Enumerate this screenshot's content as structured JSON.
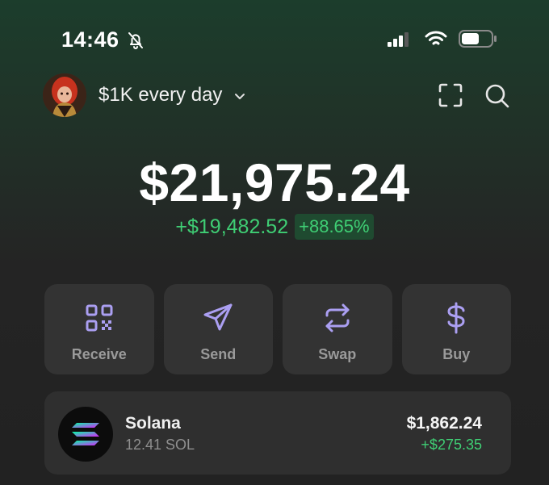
{
  "status_bar": {
    "time": "14:46",
    "icons": [
      "bell-slash-icon",
      "signal-icon",
      "wifi-icon",
      "battery-icon"
    ]
  },
  "header": {
    "account_name": "$1K every day",
    "icons": [
      "avatar",
      "chevron-down-icon",
      "scan-icon",
      "search-icon"
    ]
  },
  "portfolio": {
    "balance": "$21,975.24",
    "change_amount": "+$19,482.52",
    "change_percent": "+88.65%"
  },
  "actions": [
    {
      "label": "Receive",
      "icon": "qr-code-icon"
    },
    {
      "label": "Send",
      "icon": "send-icon"
    },
    {
      "label": "Swap",
      "icon": "swap-icon"
    },
    {
      "label": "Buy",
      "icon": "dollar-icon"
    }
  ],
  "tokens": [
    {
      "name": "Solana",
      "quantity": "12.41 SOL",
      "value": "$1,862.24",
      "change": "+$275.35",
      "icon": "solana-icon"
    }
  ],
  "colors": {
    "accent": "#ab9ff2",
    "positive": "#3fce74",
    "card": "#333333"
  }
}
